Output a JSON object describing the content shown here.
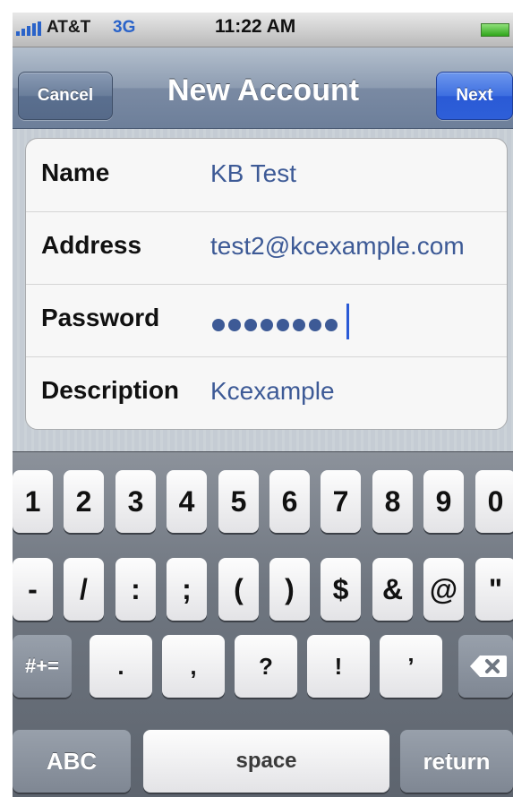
{
  "status_bar": {
    "carrier": "AT&T",
    "network": "3G",
    "time": "11:22 AM",
    "icons": [
      "signal-icon",
      "battery-icon"
    ]
  },
  "nav": {
    "title": "New Account",
    "cancel_label": "Cancel",
    "next_label": "Next"
  },
  "form": {
    "fields": [
      {
        "label": "Name",
        "value": "KB Test"
      },
      {
        "label": "Address",
        "value": "test2@kcexample.com"
      },
      {
        "label": "Password",
        "value": "••••••••",
        "masked_length": 8
      },
      {
        "label": "Description",
        "value": "Kcexample"
      }
    ]
  },
  "keyboard": {
    "row1": [
      "1",
      "2",
      "3",
      "4",
      "5",
      "6",
      "7",
      "8",
      "9",
      "0"
    ],
    "row2": [
      "-",
      "/",
      ":",
      ";",
      "(",
      ")",
      "$",
      "&",
      "@",
      "\""
    ],
    "row3_left": "#+=",
    "row3": [
      ".",
      ",",
      "?",
      "!",
      "’"
    ],
    "abc_label": "ABC",
    "space_label": "space",
    "return_label": "return"
  },
  "colors": {
    "value_text": "#3d5a96",
    "next_button": "#2e5fd8",
    "battery": "#2fa61a"
  }
}
